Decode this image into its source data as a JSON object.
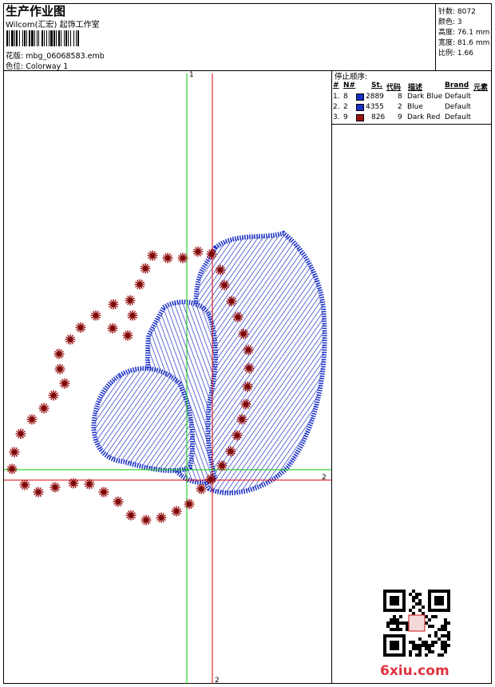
{
  "header": {
    "title": "生产作业图",
    "company": "Wilcom(汇宏) 起饰工作室",
    "design_label": "花版:",
    "design_value": "mbg_06068583.emb",
    "color_label": "色位:",
    "color_value": "Colorway 1"
  },
  "stats": {
    "stitches_label": "针数:",
    "stitches_value": "8072",
    "colors_label": "颜色:",
    "colors_value": "3",
    "height_label": "高度:",
    "height_value": "76.1 mm",
    "width_label": "宽度:",
    "width_value": "81.6 mm",
    "scale_label": "比例:",
    "scale_value": "1.66"
  },
  "stop_sequence": {
    "title": "停止顺序:",
    "headers": [
      "#",
      "N#",
      "St.",
      "代码",
      "描述",
      "Brand",
      "元素"
    ],
    "rows": [
      {
        "index": "1.",
        "needle": "8",
        "stitches": "2889",
        "code": "8",
        "description": "Dark Blue",
        "brand": "Default",
        "color": "#1a2fc4"
      },
      {
        "index": "2.",
        "needle": "2",
        "stitches": "4355",
        "code": "2",
        "description": "Blue",
        "brand": "Default",
        "color": "#1a2fc4"
      },
      {
        "index": "3.",
        "needle": "9",
        "stitches": "826",
        "code": "9",
        "description": "Dark Red",
        "brand": "Default",
        "color": "#9b1111"
      }
    ]
  },
  "axes": {
    "top_label": "1",
    "right_label": "2",
    "bottom_label": "2"
  },
  "watermark": "6xiu.com",
  "colors": {
    "thread_blue": "#1a2fc4",
    "thread_red": "#9b1111",
    "guide_green": "#00c800",
    "guide_red": "#e00000"
  }
}
